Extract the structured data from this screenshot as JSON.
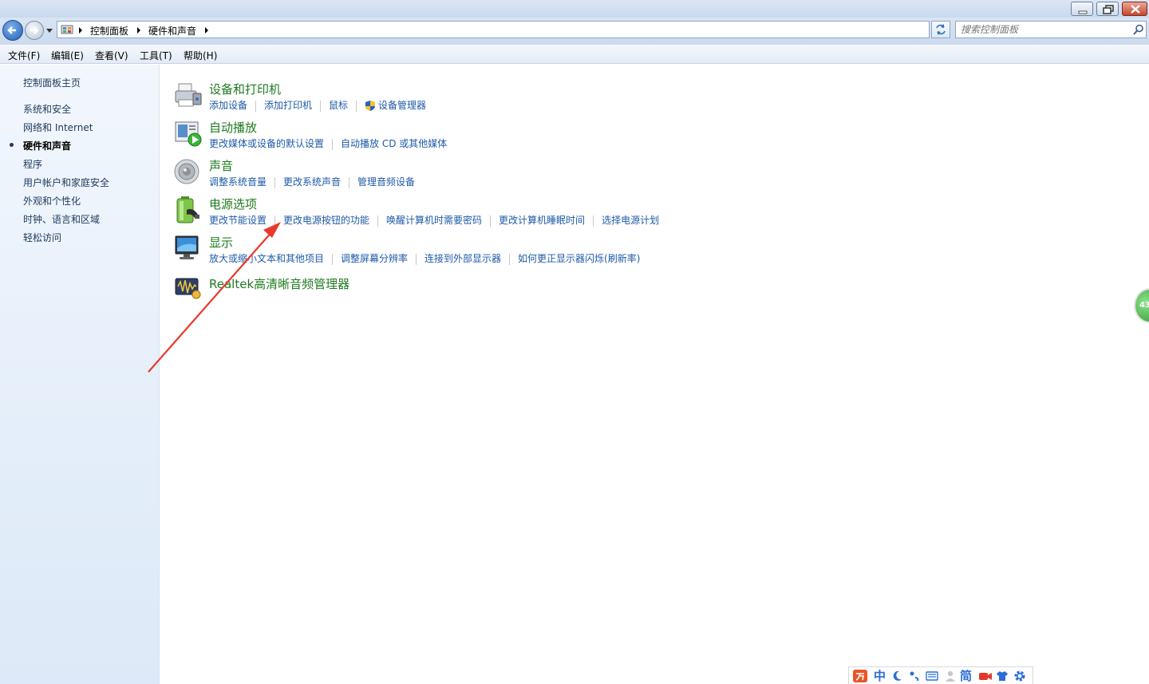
{
  "window": {
    "breadcrumb": [
      "控制面板",
      "硬件和声音"
    ],
    "search_placeholder": "搜索控制面板"
  },
  "menu": [
    "文件(F)",
    "编辑(E)",
    "查看(V)",
    "工具(T)",
    "帮助(H)"
  ],
  "sidebar": {
    "home": "控制面板主页",
    "items": [
      {
        "label": "系统和安全",
        "active": false
      },
      {
        "label": "网络和 Internet",
        "active": false
      },
      {
        "label": "硬件和声音",
        "active": true
      },
      {
        "label": "程序",
        "active": false
      },
      {
        "label": "用户帐户和家庭安全",
        "active": false
      },
      {
        "label": "外观和个性化",
        "active": false
      },
      {
        "label": "时钟、语言和区域",
        "active": false
      },
      {
        "label": "轻松访问",
        "active": false
      }
    ]
  },
  "categories": [
    {
      "title": "设备和打印机",
      "icon": "printer-icon",
      "links": [
        "添加设备",
        "添加打印机",
        "鼠标",
        "设备管理器"
      ]
    },
    {
      "title": "自动播放",
      "icon": "autoplay-icon",
      "links": [
        "更改媒体或设备的默认设置",
        "自动播放 CD 或其他媒体"
      ]
    },
    {
      "title": "声音",
      "icon": "speaker-icon",
      "links": [
        "调整系统音量",
        "更改系统声音",
        "管理音频设备"
      ]
    },
    {
      "title": "电源选项",
      "icon": "battery-icon",
      "links": [
        "更改节能设置",
        "更改电源按钮的功能",
        "唤醒计算机时需要密码",
        "更改计算机睡眠时间",
        "选择电源计划"
      ]
    },
    {
      "title": "显示",
      "icon": "monitor-icon",
      "links": [
        "放大或缩小文本和其他项目",
        "调整屏幕分辨率",
        "连接到外部显示器",
        "如何更正显示器闪烁(刷新率)"
      ]
    },
    {
      "title": "Realtek高清晰音频管理器",
      "icon": "realtek-audio-icon",
      "links": []
    }
  ],
  "side_widget_text": "43",
  "ime_toolbar": [
    "中",
    "简"
  ],
  "colors": {
    "link": "#1e5aa8",
    "category_title": "#1f7a1f",
    "annotation_arrow": "#e83a2c"
  }
}
